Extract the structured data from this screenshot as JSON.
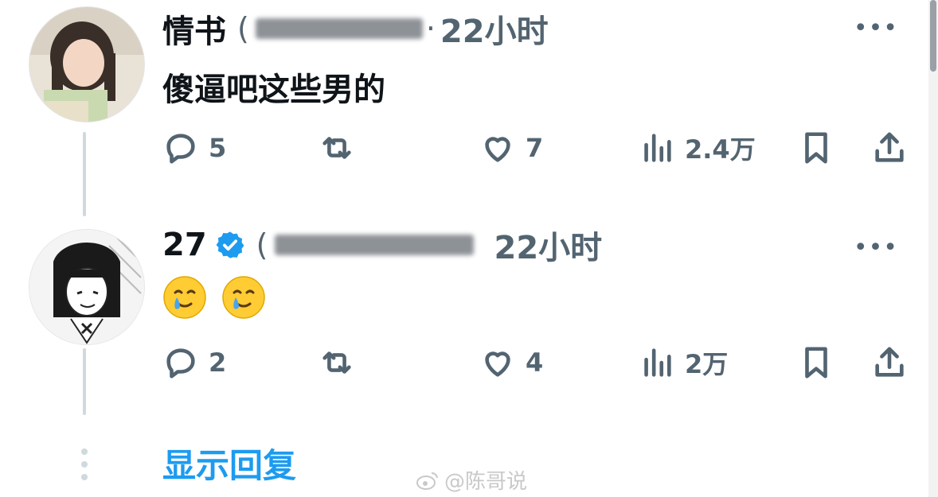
{
  "posts": [
    {
      "name": "情书",
      "handle_open": "(",
      "time_sep": "·",
      "time": "22小时",
      "text": "傻逼吧这些男的",
      "verified": false,
      "counts": {
        "replies": "5",
        "likes": "7",
        "views": "2.4万"
      }
    },
    {
      "name": "27",
      "handle_open": "(",
      "time": "22小时",
      "emoji": "crying-smile-emoji",
      "verified": true,
      "counts": {
        "replies": "2",
        "likes": "4",
        "views": "2万"
      }
    }
  ],
  "show_replies": "显示回复",
  "watermark": "@陈哥说",
  "colors": {
    "accent": "#1d9bf0",
    "muted": "#536471",
    "text": "#0f1419",
    "thread": "#cfd9de"
  }
}
